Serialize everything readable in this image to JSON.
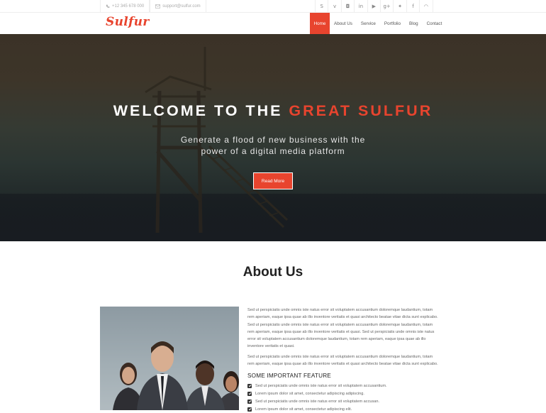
{
  "topbar": {
    "phone": "+12 345 678 000",
    "email": "support@sulfur.com",
    "social": [
      {
        "name": "skype-icon",
        "glyph": "S"
      },
      {
        "name": "vimeo-icon",
        "glyph": "v"
      },
      {
        "name": "instagram-icon",
        "glyph": "◘"
      },
      {
        "name": "linkedin-icon",
        "glyph": "in"
      },
      {
        "name": "youtube-icon",
        "glyph": "▶"
      },
      {
        "name": "google-plus-icon",
        "glyph": "g+"
      },
      {
        "name": "twitter-icon",
        "glyph": "✦"
      },
      {
        "name": "facebook-icon",
        "glyph": "f"
      },
      {
        "name": "rss-icon",
        "glyph": "◠"
      }
    ]
  },
  "header": {
    "logo": "Sulfur",
    "nav": [
      "Home",
      "About Us",
      "Service",
      "Portfolio",
      "Blog",
      "Contact"
    ],
    "active": "Home"
  },
  "hero": {
    "title_part1": "WELCOME TO THE ",
    "title_part2": "GREAT SULFUR",
    "subtitle_line1": "Generate a flood of new business with the",
    "subtitle_line2": "power of a digital media platform",
    "button": "Read More"
  },
  "about": {
    "title": "About Us",
    "paragraph1": "Sed ut perspiciatis unde omnis iste natus error sit voluptatem accusantium doloremque laudantium, totam rem aperiam, eaque ipsa quae ab illo inventore veritatis et quasi architecto beatae vitae dicta sunt explicabo. Sed ut perspiciatis unde omnis iste natus error sit voluptatem accusantium doloremque laudantium, totam rem aperiam, eaque ipsa quae ab illo inventore veritatis et quasi. Sed ut perspiciatis unde omnis iste natus error sit voluptatem accusantium doloremque laudantium, totam rem aperiam, eaque ipsa quae ab illo inventore veritatis et quasi.",
    "paragraph2": "Sed ut perspiciatis unde omnis iste natus error sit voluptatem accusantium doloremque laudantium, totam rem aperiam, eaque ipsa quae ab illo inventore veritatis et quasi architecto beatae vitae dicta sunt explicabo.",
    "feature_title": "SOME IMPORTANT FEATURE",
    "features": [
      "Sed ut perspiciatis unde omnis iste natus error sit voluptatem accusantium.",
      "Lorem ipsum dolor sit amet, consectetur adipiscing adipiscing.",
      "Sed ut perspiciatis unde omnis iste natus error sit voluptatem accusan.",
      "Lorem ipsum dolor sit amet, consectetur adipiscing elit."
    ]
  },
  "colors": {
    "accent": "#e8442e"
  }
}
